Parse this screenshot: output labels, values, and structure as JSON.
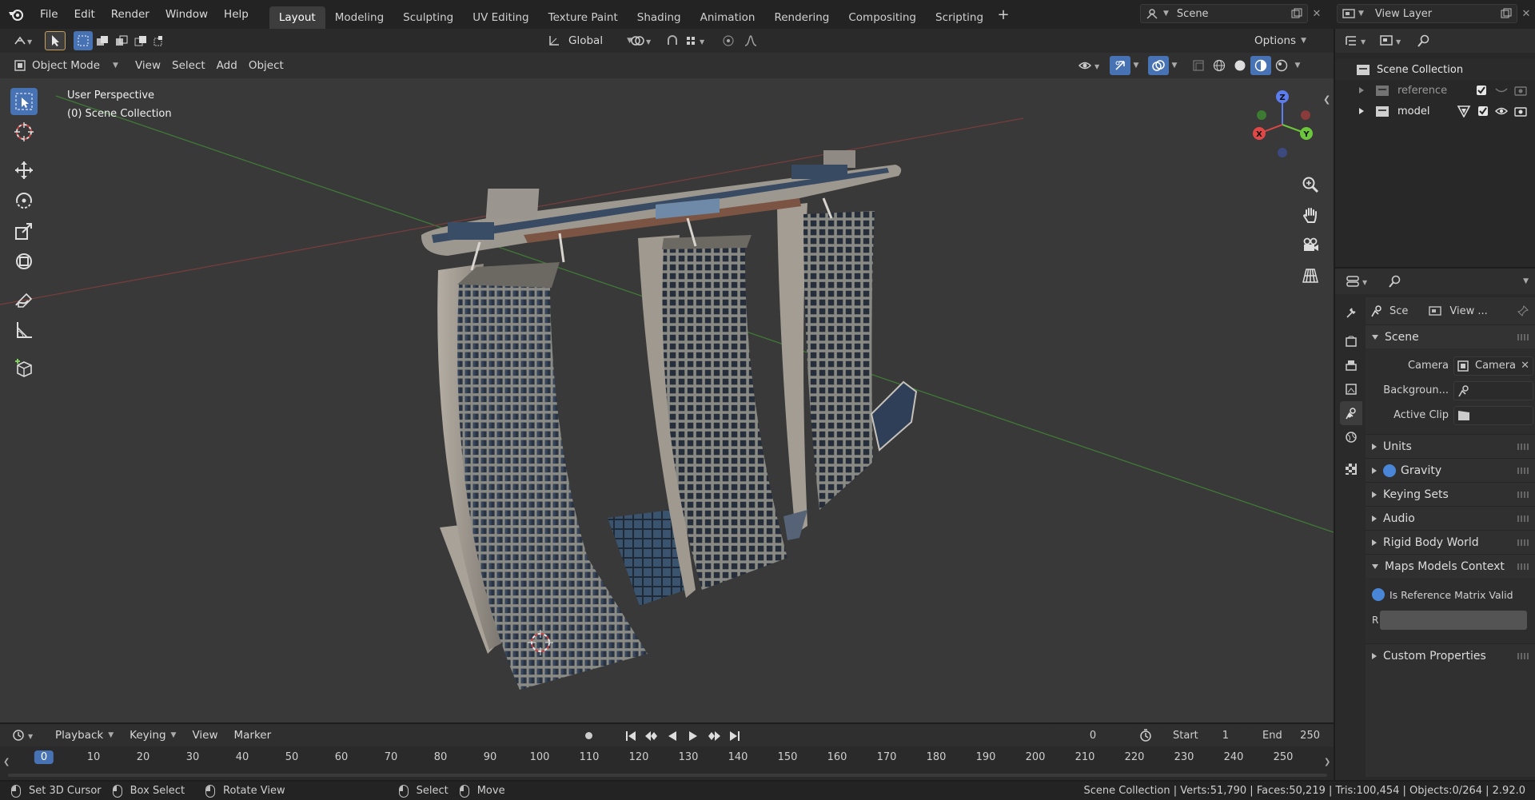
{
  "menus": [
    "File",
    "Edit",
    "Render",
    "Window",
    "Help"
  ],
  "workspaces": [
    {
      "label": "Layout",
      "active": true
    },
    {
      "label": "Modeling"
    },
    {
      "label": "Sculpting"
    },
    {
      "label": "UV Editing"
    },
    {
      "label": "Texture Paint"
    },
    {
      "label": "Shading"
    },
    {
      "label": "Animation"
    },
    {
      "label": "Rendering"
    },
    {
      "label": "Compositing"
    },
    {
      "label": "Scripting"
    }
  ],
  "add_workspace": "+",
  "scene_name": "Scene",
  "view_layer": "View Layer",
  "tool_header": {
    "orientation": "Global",
    "options": "Options"
  },
  "viewport_header": {
    "mode": "Object Mode",
    "menus": [
      "View",
      "Select",
      "Add",
      "Object"
    ]
  },
  "viewport": {
    "perspective": "User Perspective",
    "collection": "(0) Scene Collection",
    "gizmo": {
      "x": "X",
      "y": "Y",
      "z": "Z"
    }
  },
  "outliner": {
    "root": "Scene Collection",
    "items": [
      {
        "label": "reference"
      },
      {
        "label": "model"
      }
    ]
  },
  "properties": {
    "tabs": [
      "Sce",
      "View ..."
    ],
    "scene_header": "Scene",
    "camera_label": "Camera",
    "camera_value": "Camera",
    "background_label": "Backgroun...",
    "active_clip_label": "Active Clip",
    "sections": [
      "Units",
      "Gravity",
      "Keying Sets",
      "Audio",
      "Rigid Body World"
    ],
    "maps_section": "Maps Models Context",
    "is_ref_valid": "Is Reference Matrix Valid",
    "r_label": "R",
    "custom_props": "Custom Properties"
  },
  "timeline": {
    "menus": [
      "Playback",
      "Keying",
      "View",
      "Marker"
    ],
    "current_frame": "0",
    "start_label": "Start",
    "start": "1",
    "end_label": "End",
    "end": "250",
    "ticks": [
      "0",
      "10",
      "20",
      "30",
      "40",
      "50",
      "60",
      "70",
      "80",
      "90",
      "100",
      "110",
      "120",
      "130",
      "140",
      "150",
      "160",
      "170",
      "180",
      "190",
      "200",
      "210",
      "220",
      "230",
      "240",
      "250"
    ],
    "current_tick": "0"
  },
  "status": {
    "set_cursor": "Set 3D Cursor",
    "box_select": "Box Select",
    "rotate_view": "Rotate View",
    "select": "Select",
    "move": "Move",
    "stats": "Scene Collection | Verts:51,790 | Faces:50,219 | Tris:100,454 | Objects:0/264 | 2.92.0"
  },
  "colors": {
    "accent": "#4772b3",
    "x_axis": "#e04848",
    "y_axis": "#6cc63c",
    "z_axis": "#5b7df0"
  }
}
